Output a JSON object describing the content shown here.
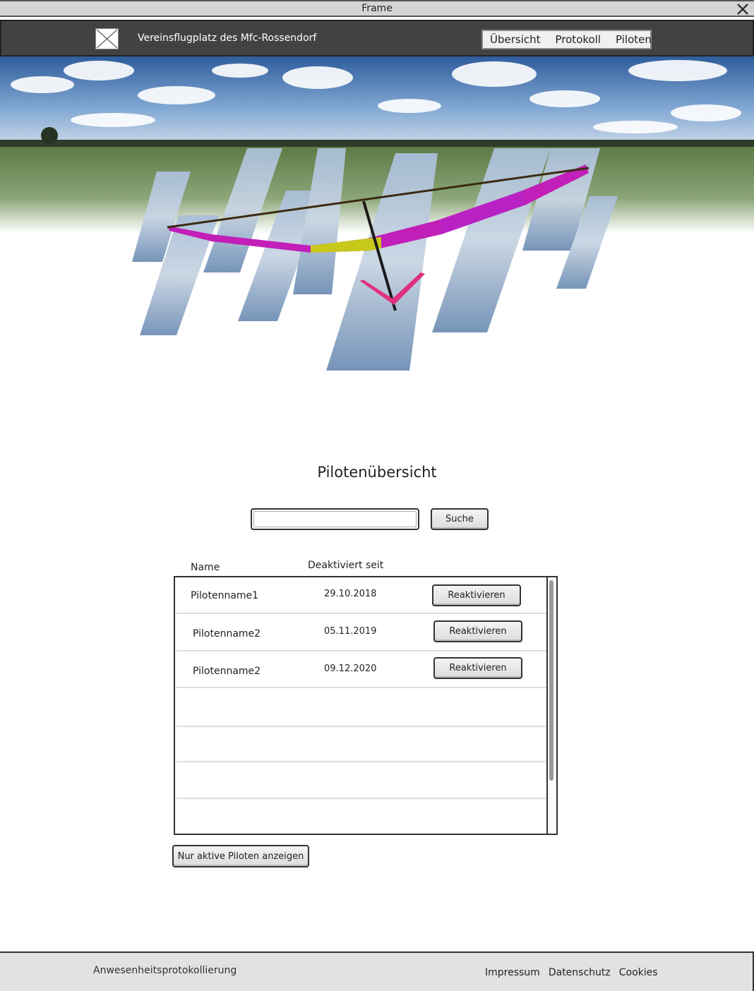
{
  "frame": {
    "title": "Frame"
  },
  "header": {
    "site_title": "Vereinsflugplatz des Mfc-Rossendorf",
    "nav": [
      {
        "label": "Übersicht"
      },
      {
        "label": "Protokoll"
      },
      {
        "label": "Piloten"
      }
    ]
  },
  "main": {
    "title": "Pilotenübersicht",
    "search": {
      "value": "",
      "placeholder": "",
      "button_label": "Suche"
    },
    "columns": {
      "name": "Name",
      "deactivated_since": "Deaktiviert seit"
    },
    "rows": [
      {
        "name": "Pilotenname1",
        "date": "29.10.2018",
        "action": "Reaktivieren"
      },
      {
        "name": "Pilotenname2",
        "date": "05.11.2019",
        "action": "Reaktivieren"
      },
      {
        "name": "Pilotenname2",
        "date": "09.12.2020",
        "action": "Reaktivieren"
      }
    ],
    "only_active_label": "Nur aktive Piloten anzeigen"
  },
  "footer": {
    "brand": "Anwesenheitsprotokollierung",
    "links": [
      {
        "label": "Impressum"
      },
      {
        "label": "Datenschutz"
      },
      {
        "label": "Cookies"
      }
    ]
  },
  "colors": {
    "header_bg": "#424242",
    "footer_bg": "#e2e2e2",
    "wing_magenta": "#c21fb8",
    "wing_yellow": "#c8c81a"
  }
}
